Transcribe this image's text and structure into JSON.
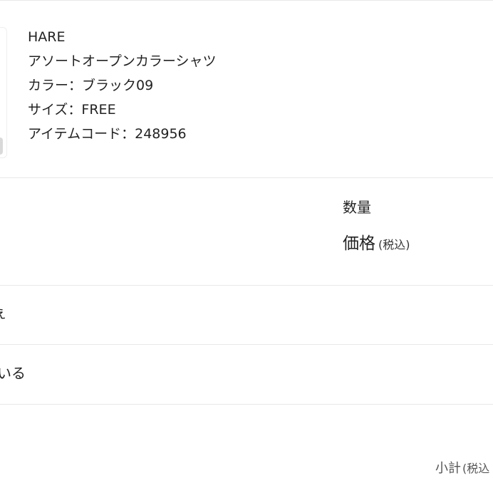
{
  "product": {
    "brand": "HARE",
    "name": "アソートオープンカラーシャツ",
    "color": "カラー：ブラック09",
    "size": "サイズ：FREE",
    "item_code": "アイテムコード：248956"
  },
  "cart": {
    "quantity_label": "数量",
    "price_label": "価格",
    "price_tax_note": "(税込)",
    "subtotal_label": "小計",
    "subtotal_tax_note": "(税込"
  },
  "fragments": {
    "left_cut_1": "ぇ",
    "left_cut_2": "いる"
  }
}
